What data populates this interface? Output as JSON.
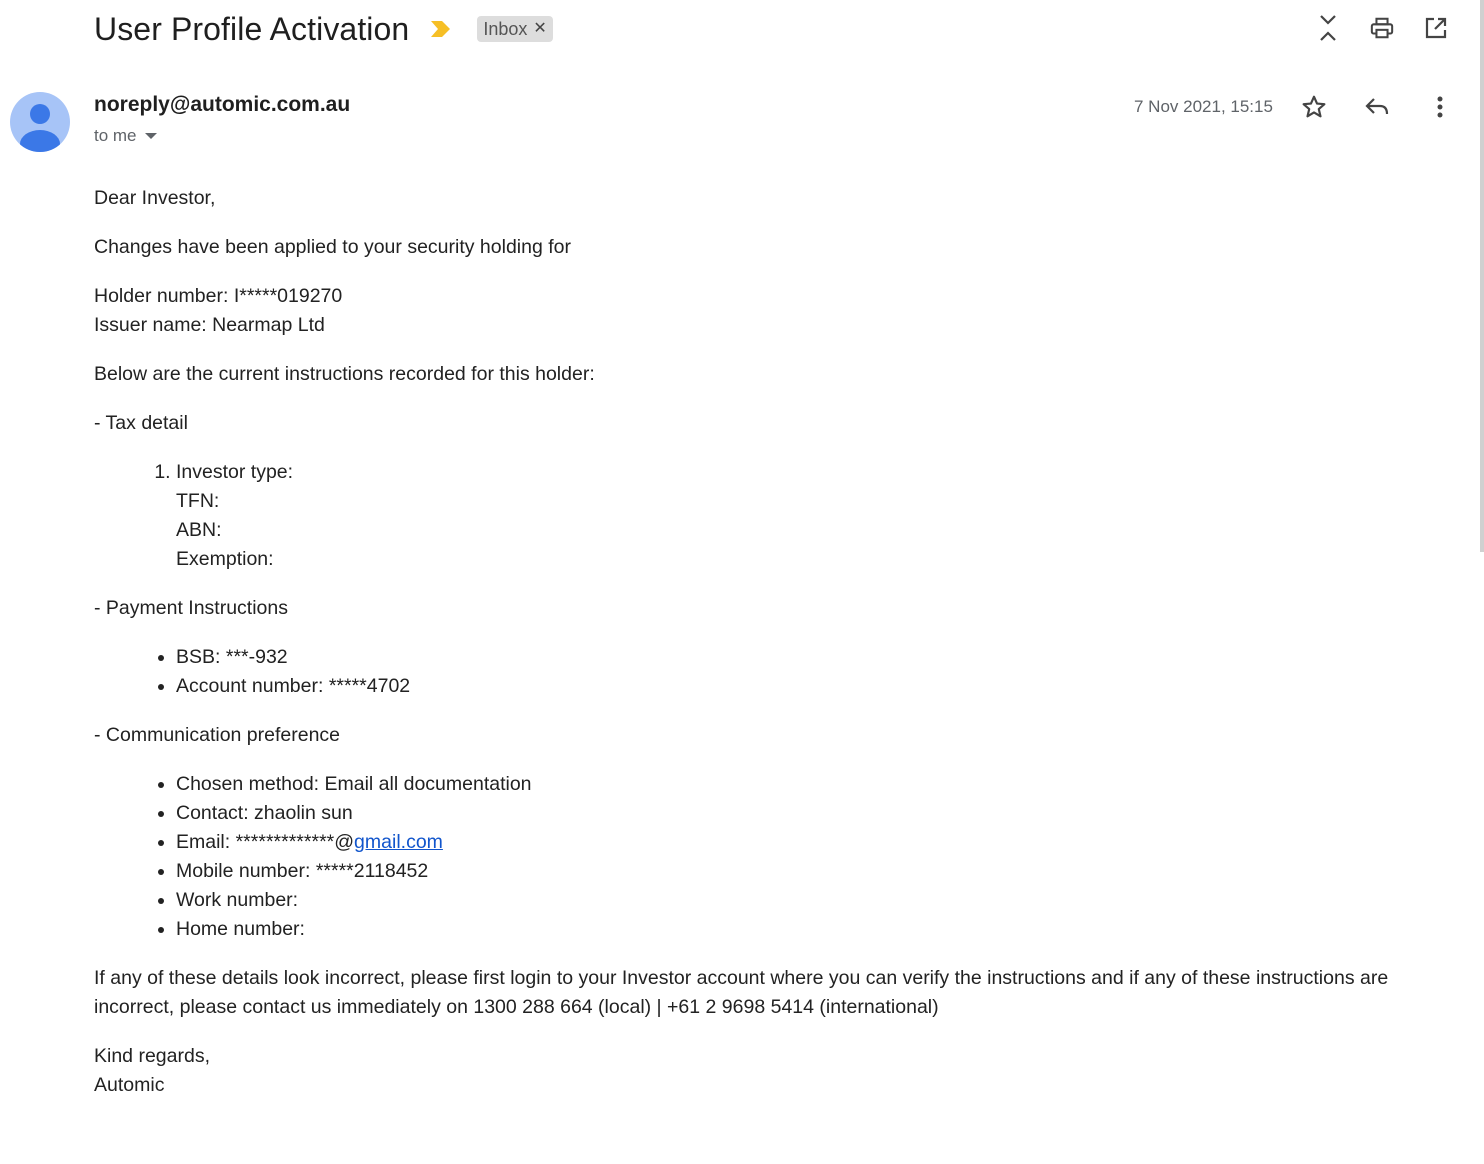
{
  "subject": "User Profile Activation",
  "label": {
    "name": "Inbox"
  },
  "toolbar": {
    "collapse_icon": "expand-collapse-icon",
    "print_icon": "print-icon",
    "open_new_window_icon": "open-in-new-icon"
  },
  "message": {
    "sender": "noreply@automic.com.au",
    "to": "to me",
    "date": "7 Nov 2021, 15:15",
    "star_icon": "star-icon",
    "reply_icon": "reply-icon",
    "more_icon": "more-vertical-icon"
  },
  "body": {
    "greeting": "Dear Investor,",
    "intro": "Changes have been applied to your security holding for",
    "holder_number": "Holder number: I*****019270",
    "issuer_name": "Issuer name: Nearmap Ltd",
    "instructions_intro": "Below are the current instructions recorded for this holder:",
    "tax_heading": "- Tax detail",
    "tax_items": [
      "Investor type:",
      "TFN:",
      "ABN:",
      "Exemption:"
    ],
    "payment_heading": "- Payment Instructions",
    "payment_items": [
      "BSB: ***-932",
      "Account number: *****4702"
    ],
    "comm_heading": "- Communication preference",
    "comm_items": [
      "Chosen method: Email all documentation",
      "Contact: zhaolin sun"
    ],
    "email_prefix": "Email: *************@",
    "email_link": "gmail.com",
    "comm_items_after": [
      "Mobile number: *****2118452",
      "Work number:",
      "Home number:"
    ],
    "warning": "If any of these details look incorrect, please first login to your Investor account where you can verify the instructions and if any of these instructions are incorrect, please contact us immediately on 1300 288 664 (local) | +61 2 9698 5414 (international)",
    "closing": "Kind regards,",
    "signature": "Automic"
  },
  "colors": {
    "importance": "#f6bf26",
    "link": "#1155cc",
    "avatar_bg": "#a7c4f7",
    "avatar_fg": "#3b78e7"
  }
}
